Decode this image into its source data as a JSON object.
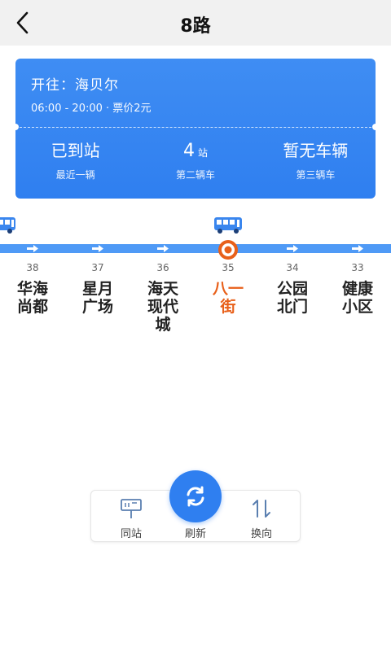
{
  "header": {
    "title": "8路"
  },
  "card": {
    "destination": "开往：海贝尔",
    "hours": "06:00 - 20:00 · 票价2元",
    "vehicles": [
      {
        "status": "已到站",
        "label": "最近一辆"
      },
      {
        "status_number": "4",
        "status_unit": "站",
        "label": "第二辆车"
      },
      {
        "status": "暂无车辆",
        "label": "第三辆车"
      }
    ]
  },
  "stations": [
    {
      "number": "38",
      "name": "华海尚都"
    },
    {
      "number": "37",
      "name": "星月广场"
    },
    {
      "number": "36",
      "name": "海天现代城"
    },
    {
      "number": "35",
      "name": "八一街",
      "current": true
    },
    {
      "number": "34",
      "name": "公园北门"
    },
    {
      "number": "33",
      "name": "健康小区"
    }
  ],
  "toolbar": {
    "same_station_label": "同站",
    "refresh_label": "刷新",
    "reverse_label": "换向"
  },
  "colors": {
    "primary": "#2f7ff0",
    "track": "#4f9af6",
    "current_station": "#e8601a"
  },
  "icons": {
    "back": "chevron-left-icon",
    "bus": "bus-icon",
    "pin": "location-pin-icon",
    "station_sign": "bus-stop-sign-icon",
    "refresh": "refresh-icon",
    "reverse": "swap-arrows-icon"
  }
}
